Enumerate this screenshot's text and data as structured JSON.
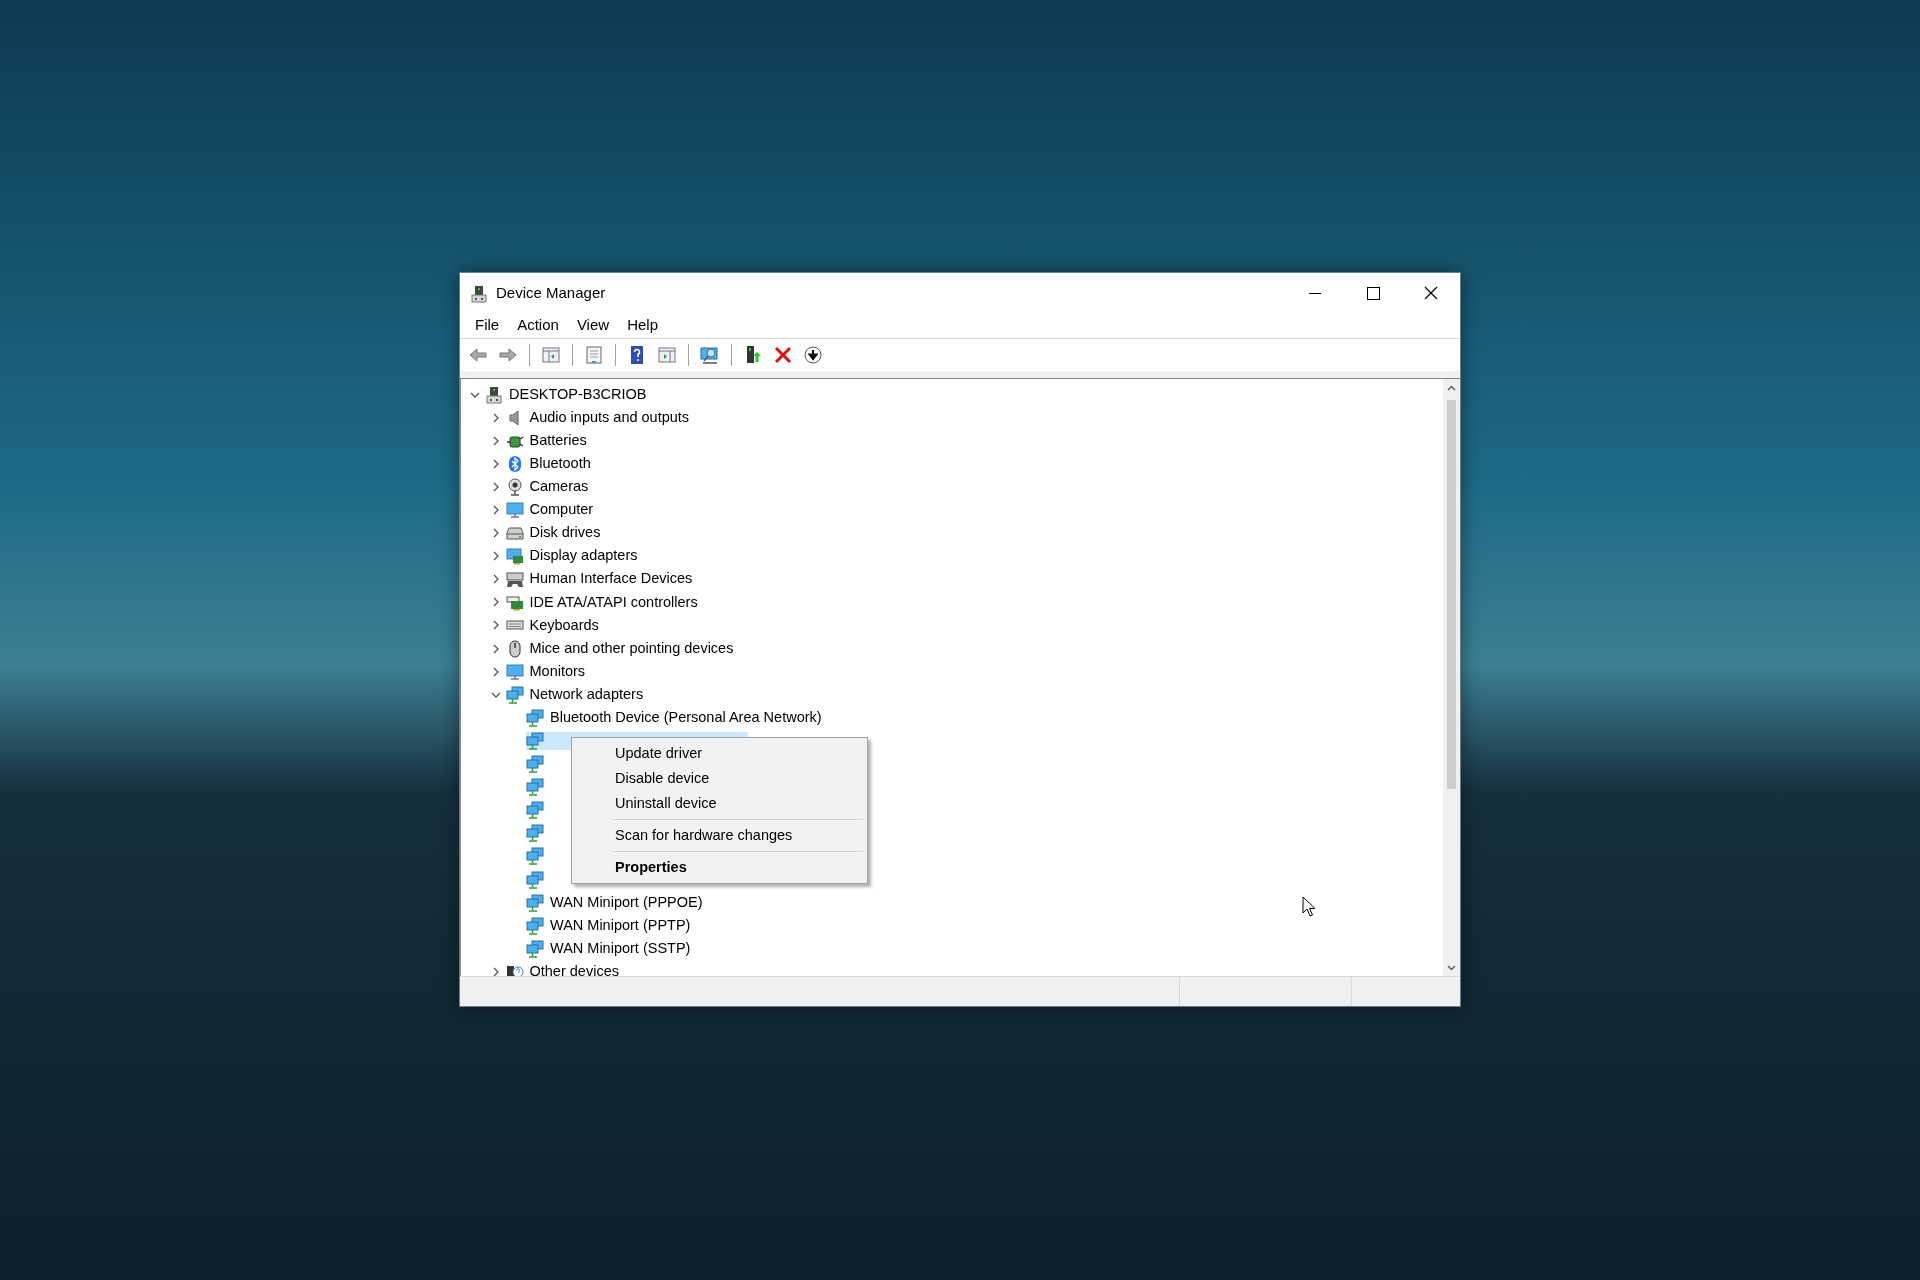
{
  "window": {
    "title": "Device Manager"
  },
  "menu_bar": [
    "File",
    "Action",
    "View",
    "Help"
  ],
  "toolbar": [
    {
      "kind": "back"
    },
    {
      "kind": "forward"
    },
    {
      "kind": "separator"
    },
    {
      "kind": "console-tree"
    },
    {
      "kind": "separator"
    },
    {
      "kind": "properties"
    },
    {
      "kind": "separator"
    },
    {
      "kind": "help"
    },
    {
      "kind": "action-pane"
    },
    {
      "kind": "separator"
    },
    {
      "kind": "scan"
    },
    {
      "kind": "separator"
    },
    {
      "kind": "update"
    },
    {
      "kind": "uninstall"
    },
    {
      "kind": "disable"
    }
  ],
  "tree": {
    "label": "DESKTOP-B3CRIOB",
    "kind": "pc",
    "expanded": true,
    "selected": false,
    "children": [
      {
        "label": "Audio inputs and outputs",
        "kind": "audio",
        "expanded": false,
        "selected": false
      },
      {
        "label": "Batteries",
        "kind": "battery",
        "expanded": false,
        "selected": false
      },
      {
        "label": "Bluetooth",
        "kind": "bluetooth",
        "expanded": false,
        "selected": false
      },
      {
        "label": "Cameras",
        "kind": "camera",
        "expanded": false,
        "selected": false
      },
      {
        "label": "Computer",
        "kind": "computer",
        "expanded": false,
        "selected": false
      },
      {
        "label": "Disk drives",
        "kind": "disk",
        "expanded": false,
        "selected": false
      },
      {
        "label": "Display adapters",
        "kind": "display",
        "expanded": false,
        "selected": false
      },
      {
        "label": "Human Interface Devices",
        "kind": "hid",
        "expanded": false,
        "selected": false
      },
      {
        "label": "IDE ATA/ATAPI controllers",
        "kind": "ide",
        "expanded": false,
        "selected": false
      },
      {
        "label": "Keyboards",
        "kind": "keyboard",
        "expanded": false,
        "selected": false
      },
      {
        "label": "Mice and other pointing devices",
        "kind": "mouse",
        "expanded": false,
        "selected": false
      },
      {
        "label": "Monitors",
        "kind": "monitor",
        "expanded": false,
        "selected": false
      },
      {
        "label": "Network adapters",
        "kind": "network",
        "expanded": true,
        "selected": false,
        "children": [
          {
            "label": "Bluetooth Device (Personal Area Network)",
            "kind": "network",
            "selected": false
          },
          {
            "kind": "network",
            "selected": true
          },
          {
            "kind": "network",
            "selected": false
          },
          {
            "kind": "network",
            "selected": false
          },
          {
            "kind": "network",
            "selected": false
          },
          {
            "kind": "network",
            "selected": false
          },
          {
            "kind": "network",
            "selected": false
          },
          {
            "kind": "network",
            "selected": false
          },
          {
            "label": "WAN Miniport (PPPOE)",
            "kind": "network",
            "selected": false
          },
          {
            "label": "WAN Miniport (PPTP)",
            "kind": "network",
            "selected": false
          },
          {
            "label": "WAN Miniport (SSTP)",
            "kind": "network",
            "selected": false
          }
        ]
      },
      {
        "label": "Other devices",
        "kind": "other",
        "expanded": false,
        "selected": false
      }
    ]
  },
  "context_menu": [
    {
      "kind": "item",
      "label": "Update driver",
      "default": false
    },
    {
      "kind": "item",
      "label": "Disable device",
      "default": false
    },
    {
      "kind": "item",
      "label": "Uninstall device",
      "default": false
    },
    {
      "kind": "separator"
    },
    {
      "kind": "item",
      "label": "Scan for hardware changes",
      "default": false
    },
    {
      "kind": "separator"
    },
    {
      "kind": "item",
      "label": "Properties",
      "default": true
    }
  ]
}
